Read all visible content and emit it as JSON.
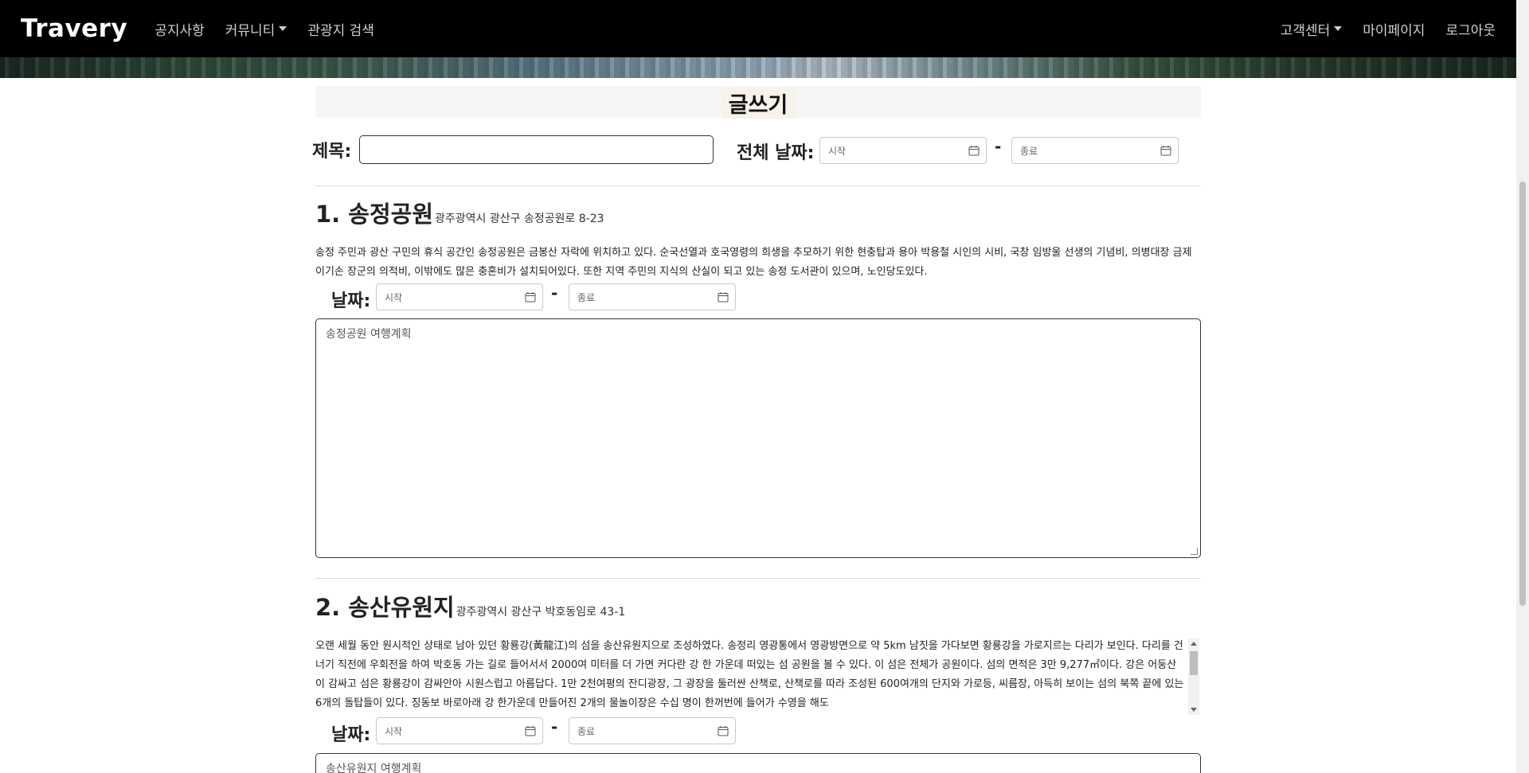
{
  "navbar": {
    "brand": "Travery",
    "left_items": [
      {
        "label": "공지사항",
        "dropdown": false
      },
      {
        "label": "커뮤니티",
        "dropdown": true
      },
      {
        "label": "관광지 검색",
        "dropdown": false
      }
    ],
    "right_items": [
      {
        "label": "고객센터",
        "dropdown": true
      },
      {
        "label": "마이페이지",
        "dropdown": false
      },
      {
        "label": "로그아웃",
        "dropdown": false
      }
    ]
  },
  "page": {
    "title": "글쓰기",
    "title_label": "제목:",
    "title_value": "",
    "overall_date_label": "전체 날짜:",
    "overall_start_placeholder": "시작",
    "overall_end_placeholder": "종료",
    "dash": "-"
  },
  "places": [
    {
      "heading": "1. 송정공원",
      "address": "광주광역시 광산구 송정공원로 8-23",
      "description": "송정 주민과 광산 구민의 휴식 공간인 송정공원은 금봉산 자락에 위치하고 있다. 순국선열과 호국영령의 희생을 추모하기 위한 현충탑과 용아 박용철 시인의 시비, 국창 임방울 선생의 기념비, 의병대장 금제 이기손 장군의 의적비, 이밖에도 많은 충혼비가 설치되어있다. 또한 지역 주민의 지식의 산실이 되고 있는 송정 도서관이 있으며, 노인당도있다.",
      "date_label": "날짜:",
      "start_placeholder": "시작",
      "end_placeholder": "종료",
      "plan_placeholder": "송정공원 여행계획"
    },
    {
      "heading": "2. 송산유원지",
      "address": "광주광역시 광산구 박호동임로 43-1",
      "description": "오랜 세월 동안 원시적인 상태로 남아 있던 황룡강(黃龍江)의 섬을 송산유원지으로 조성하였다. 송정리 영광통에서 영광방면으로 약 5km 남짓을 가다보면 황룡강을 가로지르는 다리가 보인다. 다리를 건너기 직전에 우회전을 하여 박호동 가는 길로 들어서서 2000여 미터를 더 가면 커다란 강 한 가운데 떠있는 섬 공원을 볼 수 있다. 이 섬은 전체가 공원이다. 섬의 면적은 3만 9,277㎡이다. 강은 어둥산이 감싸고 섬은 황룡강이 감싸안아 시원스럽고 아름답다. 1만 2천여평의 잔디광장, 그 광장을 둘러싼 산책로, 산책로를 따라 조성된 600여개의 단지와 가로등, 씨름장, 아득히 보이는 섬의 북쪽 끝에 있는 6개의 돌탑들이 있다. 징동보 바로아래 강 한가운데 만들어진 2개의 물놀이장은 수십 명이 한꺼번에 들어가 수영을 해도",
      "date_label": "날짜:",
      "start_placeholder": "시작",
      "end_placeholder": "종료",
      "plan_placeholder": "송산유원지 여행계획"
    }
  ]
}
